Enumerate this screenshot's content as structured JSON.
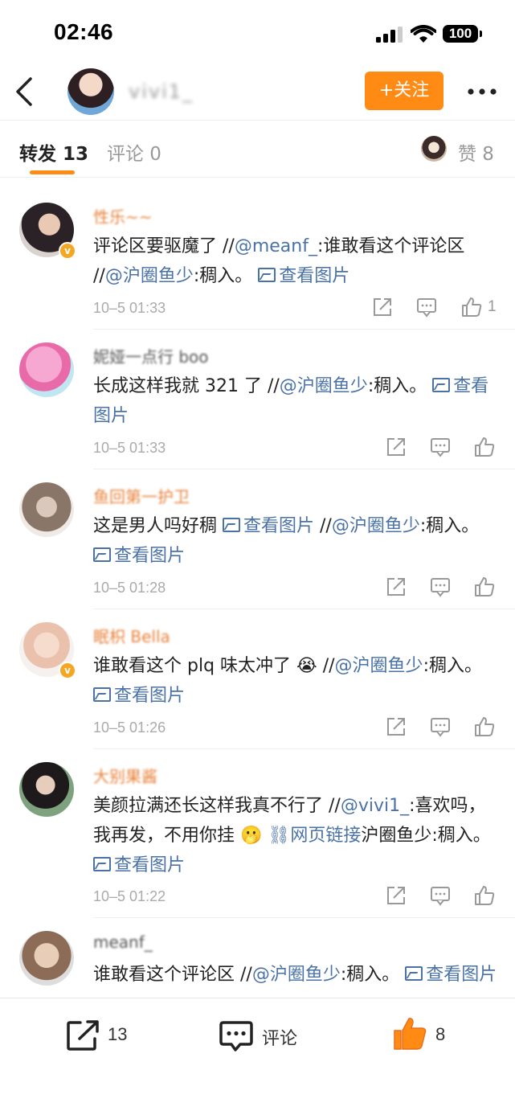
{
  "status_bar": {
    "time": "02:46",
    "battery": "100"
  },
  "header": {
    "back_icon": "chevron-left-icon",
    "name": "vivi1_",
    "follow_label": "+关注",
    "more_icon": "more-dots-icon"
  },
  "tabs": {
    "repost": "转发 13",
    "comment": "评论 0",
    "likes": "赞 8"
  },
  "colors": {
    "accent": "#ff8a14",
    "link": "#4a72a6",
    "meta": "#aaaaaa"
  },
  "items": [
    {
      "name": "性乐~~",
      "time": "10–5 01:33",
      "like_count": "1",
      "text_1": "评论区要驱魔了 //",
      "mention_1": "@meanf_",
      "text_2": ":谁敢看这个评论区 //",
      "mention_2": "@沪圈鱼少",
      "text_3": ":稠入。",
      "image_link": "查看图片"
    },
    {
      "name": "妮娅一点行 boo",
      "time": "10–5 01:33",
      "like_count": "",
      "text_1": "长成这样我就 321 了 //",
      "mention_1": "@沪圈鱼少",
      "text_2": ":稠入。",
      "image_link": "查看图片"
    },
    {
      "name": "鱼回第一护卫",
      "time": "10–5 01:28",
      "like_count": "",
      "text_1": "这是男人吗好稠 ",
      "image_link_1": "查看图片",
      "text_2": " //",
      "mention_1": "@沪圈鱼少",
      "text_3": ":稠入。",
      "image_link_2": "查看图片"
    },
    {
      "name": "眠枳 Bella",
      "time": "10–5 01:26",
      "like_count": "",
      "text_1": "谁敢看这个 plq 味太冲了 😭 //",
      "mention_1": "@沪圈鱼少",
      "text_2": ":稠入。",
      "image_link": "查看图片"
    },
    {
      "name": "大别果酱",
      "time": "10–5 01:22",
      "like_count": "",
      "text_1": "美颜拉满还长这样我真不行了 //",
      "mention_1": "@vivi1_",
      "text_2": ":喜欢吗，我再发，不用你挂 🫢 ",
      "web_link": "网页链接",
      "text_3": "沪圈鱼少:稠入。",
      "image_link": "查看图片"
    },
    {
      "name": "meanf_",
      "time": "",
      "like_count": "",
      "text_1": "谁敢看这个评论区 //",
      "mention_1": "@沪圈鱼少",
      "text_2": ":稠入。",
      "image_link": "查看图片"
    }
  ],
  "bottom_bar": {
    "repost_count": "13",
    "comment_label": "评论",
    "like_count": "8"
  }
}
